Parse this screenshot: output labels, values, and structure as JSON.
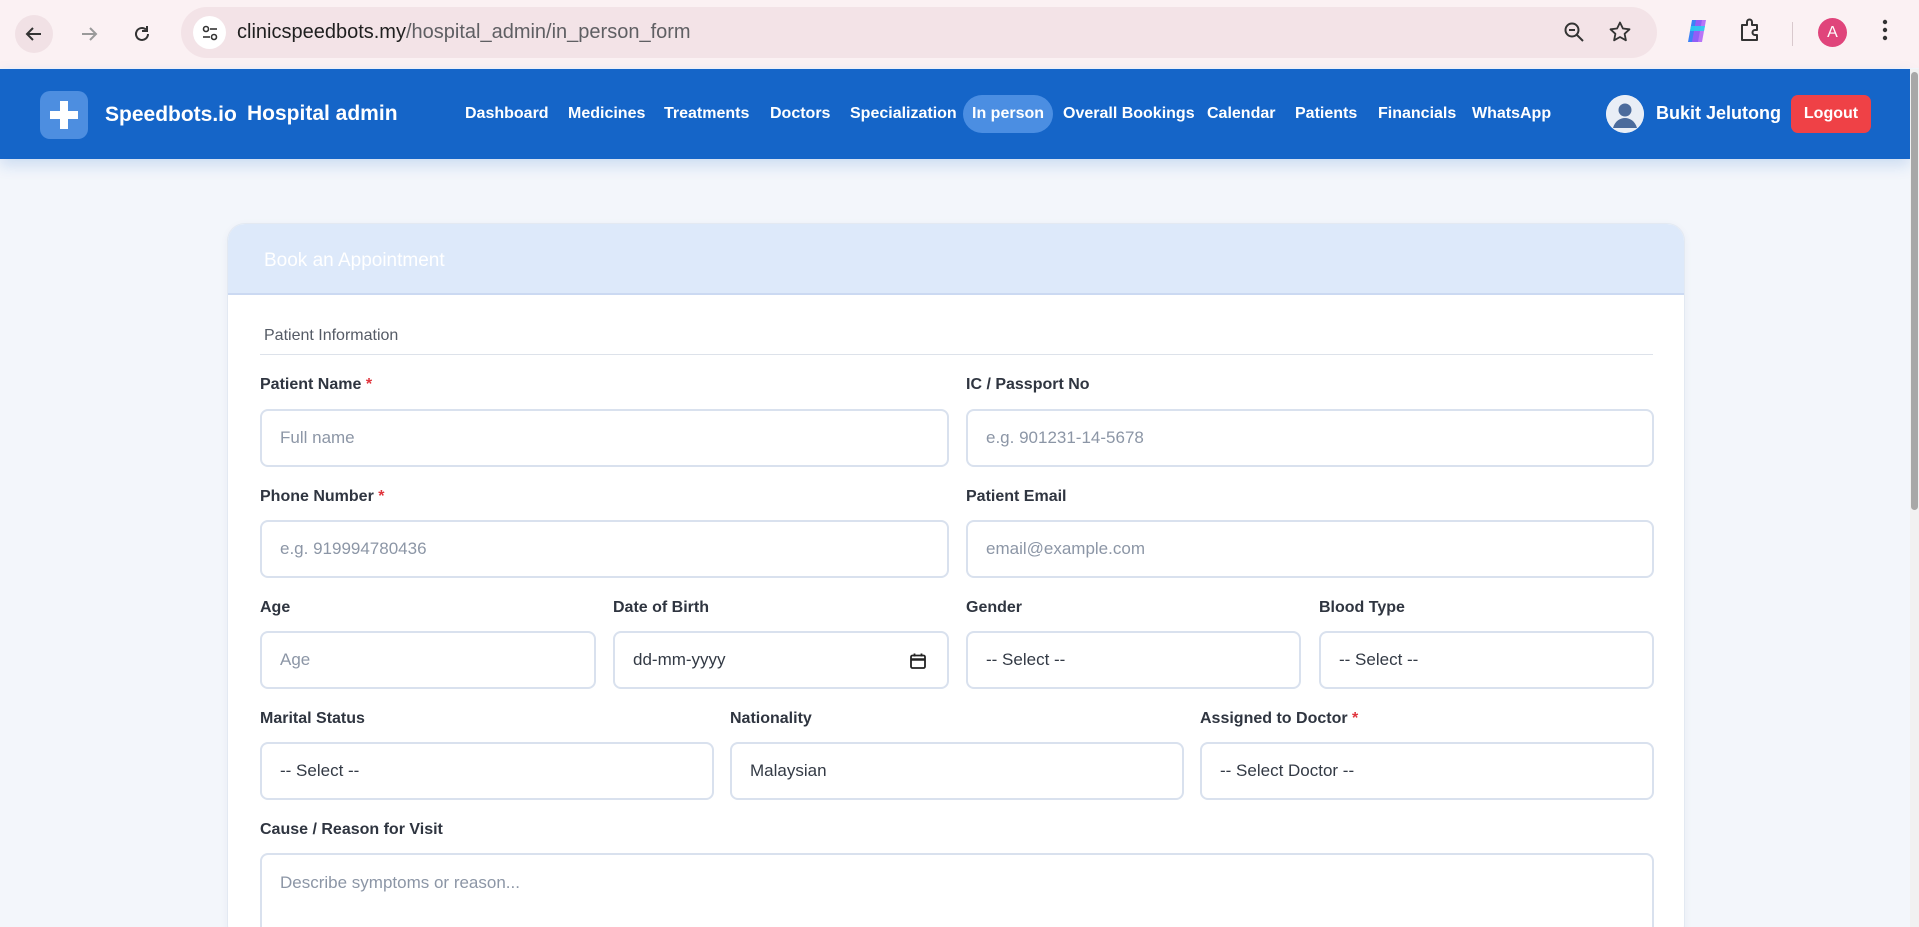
{
  "browser": {
    "url_host": "clinicspeedbots.my",
    "url_path": "/hospital_admin/in_person_form",
    "profile_initial": "A"
  },
  "navbar": {
    "brand": "Speedbots.io",
    "subtitle": "Hospital admin",
    "items": [
      {
        "label": "Dashboard"
      },
      {
        "label": "Medicines"
      },
      {
        "label": "Treatments"
      },
      {
        "label": "Doctors"
      },
      {
        "label": "Specialization"
      },
      {
        "label": "In person",
        "active": true
      },
      {
        "label": "Overall Bookings"
      },
      {
        "label": "Calendar"
      },
      {
        "label": "Patients"
      },
      {
        "label": "Financials"
      },
      {
        "label": "WhatsApp"
      }
    ],
    "user_name": "Bukit Jelutong",
    "logout_label": "Logout",
    "colors": {
      "bar": "#1565c8",
      "active_pill": "#4b8ee2",
      "logout": "#ef4146"
    }
  },
  "form": {
    "title": "Book an Appointment",
    "section": "Patient Information",
    "required_mark": "*",
    "fields": {
      "patient_name": {
        "label": "Patient Name",
        "placeholder": "Full name"
      },
      "ic_passport": {
        "label": "IC / Passport No",
        "placeholder": "e.g. 901231-14-5678"
      },
      "phone": {
        "label": "Phone Number",
        "placeholder": "e.g. 919994780436"
      },
      "email": {
        "label": "Patient Email",
        "placeholder": "email@example.com"
      },
      "age": {
        "label": "Age",
        "placeholder": "Age"
      },
      "dob": {
        "label": "Date of Birth",
        "value": "dd-mm-yyyy"
      },
      "gender": {
        "label": "Gender",
        "value": "-- Select --"
      },
      "blood_type": {
        "label": "Blood Type",
        "value": "-- Select --"
      },
      "marital_status": {
        "label": "Marital Status",
        "value": "-- Select --"
      },
      "nationality": {
        "label": "Nationality",
        "value": "Malaysian"
      },
      "doctor": {
        "label": "Assigned to Doctor",
        "value": "-- Select Doctor --"
      },
      "reason": {
        "label": "Cause / Reason for Visit",
        "placeholder": "Describe symptoms or reason..."
      }
    }
  }
}
